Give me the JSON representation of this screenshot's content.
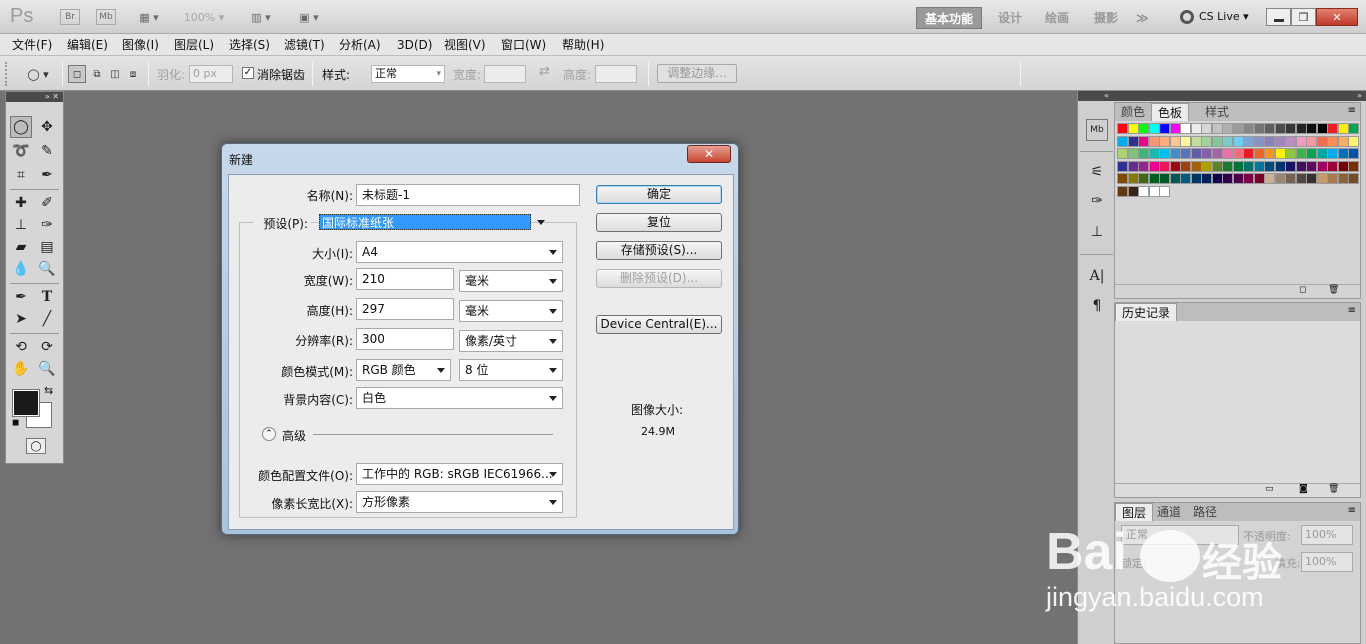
{
  "app": {
    "logo": "Ps",
    "br_badge": "Br",
    "mb_badge": "Mb",
    "zoom": "100%",
    "workspaces": [
      "基本功能",
      "设计",
      "绘画",
      "摄影"
    ],
    "more_label": "≫",
    "cs_live": "CS Live"
  },
  "menu": [
    "文件(F)",
    "编辑(E)",
    "图像(I)",
    "图层(L)",
    "选择(S)",
    "滤镜(T)",
    "分析(A)",
    "3D(D)",
    "视图(V)",
    "窗口(W)",
    "帮助(H)"
  ],
  "options": {
    "feather_label": "羽化:",
    "feather_value": "0 px",
    "antialias_label": "消除锯齿",
    "style_label": "样式:",
    "style_value": "正常",
    "width_label": "宽度:",
    "height_label": "高度:",
    "refine_button": "调整边缘..."
  },
  "right_panels": {
    "color_tabs": [
      "颜色",
      "色板",
      "样式"
    ],
    "history_tab": "历史记录",
    "layers_tabs": [
      "图层",
      "通道",
      "路径"
    ],
    "blend_mode": "正常",
    "opacity_label": "不透明度:",
    "opacity_value": "100%",
    "lock_label": "锁定:",
    "fill_label": "填充:",
    "fill_value": "100%",
    "swatch_colors": [
      [
        "#ff0000",
        "#ffff00",
        "#00ff00",
        "#00ffff",
        "#0000ff",
        "#ff00ff",
        "#ffffff",
        "#ebebeb",
        "#d7d7d7",
        "#c3c3c3",
        "#afafaf",
        "#9b9b9b",
        "#878787",
        "#737373",
        "#5f5f5f",
        "#4b4b4b",
        "#373737",
        "#232323",
        "#0f0f0f",
        "#000000",
        "#ee1d24",
        "#fff200",
        "#00a651"
      ],
      [
        "#00aeef",
        "#2e3192",
        "#ec008c",
        "#f7977a",
        "#f9ad81",
        "#fdc68a",
        "#fff79a",
        "#c4df9b",
        "#a3d39c",
        "#82ca9d",
        "#7bcdc8",
        "#6ecff6",
        "#7ea7d8",
        "#8493ca",
        "#8882be",
        "#a187be",
        "#bc8dbf",
        "#f49ac2",
        "#f6989d",
        "#f26c4f",
        "#f68e55",
        "#fbaf5c",
        "#fff467"
      ],
      [
        "#acd372",
        "#7cc576",
        "#3bb878",
        "#1abbb4",
        "#00bff3",
        "#438cca",
        "#5574b9",
        "#605ca8",
        "#855fa8",
        "#a763a8",
        "#f06ea9",
        "#f26d7d",
        "#ed1c24",
        "#f26522",
        "#f7941d",
        "#fff200",
        "#8dc73f",
        "#39b54a",
        "#00a651",
        "#00a99d",
        "#00aeef",
        "#0072bc",
        "#0054a6"
      ],
      [
        "#2e3192",
        "#662d91",
        "#92278f",
        "#ec008c",
        "#ed145b",
        "#9e0b0f",
        "#a0410d",
        "#a3620a",
        "#aba000",
        "#598527",
        "#197b30",
        "#007236",
        "#00746b",
        "#0076a3",
        "#004a80",
        "#003471",
        "#1b1464",
        "#440e62",
        "#630460",
        "#9e005d",
        "#9e0039",
        "#790000",
        "#7b2e00"
      ],
      [
        "#7d4900",
        "#827b00",
        "#406618",
        "#005e20",
        "#005826",
        "#005952",
        "#005b7f",
        "#003663",
        "#002157",
        "#0d004c",
        "#32004b",
        "#4b0049",
        "#7b0046",
        "#7a0026",
        "#c7b299",
        "#998675",
        "#736357",
        "#534741",
        "#37302d",
        "#c69c6d",
        "#a67c52",
        "#8c6239",
        "#754c24"
      ],
      [
        "#603913",
        "#3c2415",
        "#fff",
        "#fff",
        "#fff"
      ]
    ]
  },
  "dialog": {
    "title": "新建",
    "name_label": "名称(N):",
    "name_value": "未标题-1",
    "preset_label": "预设(P):",
    "preset_value": "国际标准纸张",
    "size_label": "大小(I):",
    "size_value": "A4",
    "width_label": "宽度(W):",
    "width_value": "210",
    "width_unit": "毫米",
    "height_label": "高度(H):",
    "height_value": "297",
    "height_unit": "毫米",
    "resolution_label": "分辨率(R):",
    "resolution_value": "300",
    "resolution_unit": "像素/英寸",
    "colormode_label": "颜色模式(M):",
    "colormode_value": "RGB 颜色",
    "bitdepth_value": "8 位",
    "background_label": "背景内容(C):",
    "background_value": "白色",
    "advanced_label": "高级",
    "profile_label": "颜色配置文件(O):",
    "profile_value": "工作中的 RGB: sRGB IEC61966...",
    "aspect_label": "像素长宽比(X):",
    "aspect_value": "方形像素",
    "ok_button": "确定",
    "reset_button": "复位",
    "save_preset_button": "存储预设(S)...",
    "delete_preset_button": "删除预设(D)...",
    "device_central_button": "Device Central(E)...",
    "image_size_label": "图像大小:",
    "image_size_value": "24.9M"
  },
  "watermark": {
    "brand": "Bai",
    "brand2": "经验",
    "url": "jingyan.baidu.com"
  }
}
